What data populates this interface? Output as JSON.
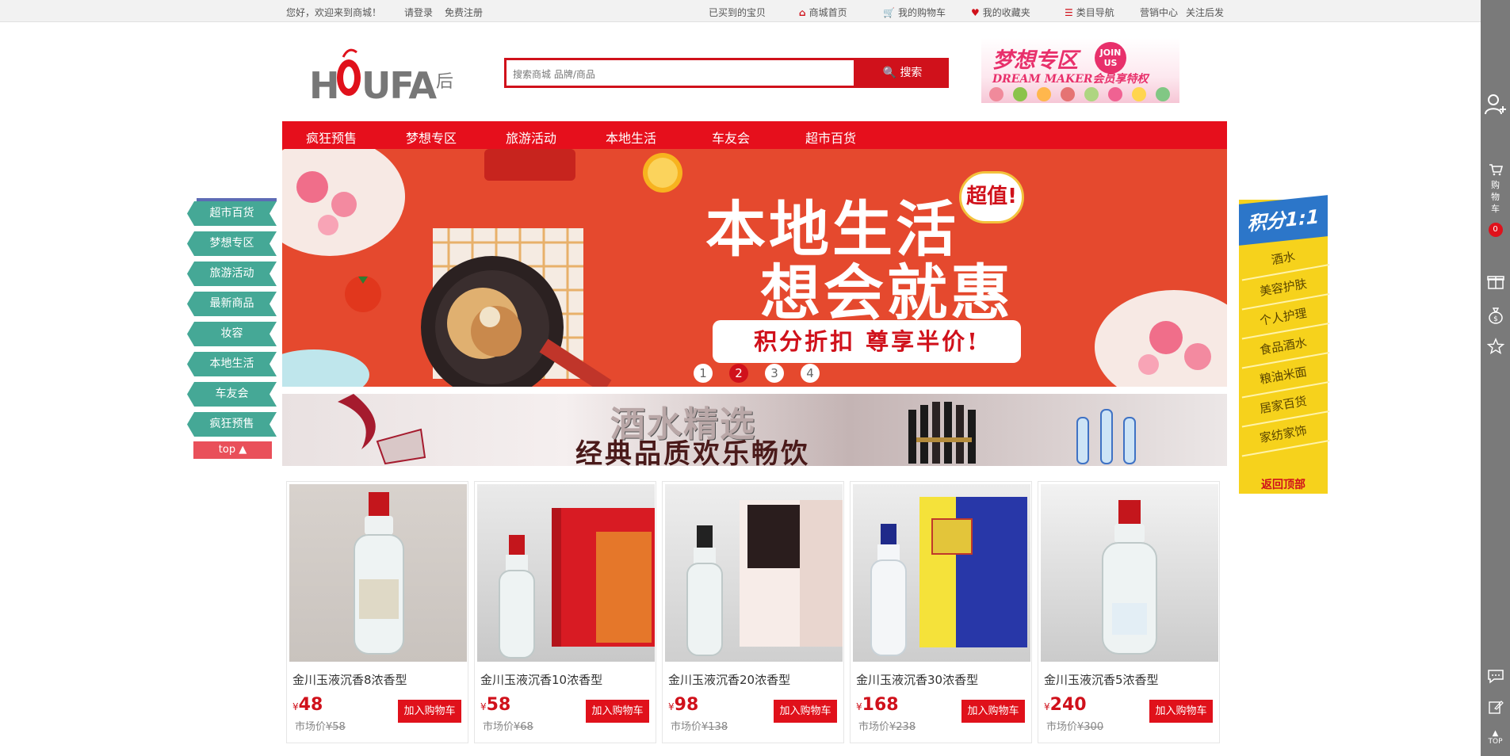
{
  "topbar": {
    "welcome": "您好，欢迎来到商城！",
    "login": "请登录",
    "register": "免费注册",
    "viewed": "已买到的宝贝",
    "home": "商城首页",
    "cart": "我的购物车",
    "favorites": "我的收藏夹",
    "categories": "类目导航",
    "marketing": "营销中心",
    "follow": "关注后发",
    "home_icon": "home-icon",
    "cart_icon": "cart-icon",
    "heart_icon": "heart-icon",
    "list_icon": "list-icon"
  },
  "logo": {
    "text": "HOUFA",
    "sub": "后发"
  },
  "search": {
    "placeholder": "搜索商城 品牌/商品",
    "button": "搜索"
  },
  "dream_ad": {
    "title": "梦想专区",
    "subtitle": "DREAM MAKER会员享特权",
    "badge_top": "JOIN",
    "badge_bottom": "US"
  },
  "nav": [
    "疯狂预售",
    "梦想专区",
    "旅游活动",
    "本地生活",
    "车友会",
    "超市百货"
  ],
  "banner": {
    "line1": "本地生活",
    "line2": "想会就惠",
    "bubble": "超值!",
    "pill": "积分折扣  尊享半价!",
    "dots": [
      "1",
      "2",
      "3",
      "4"
    ],
    "active_dot": 2
  },
  "liquor_banner": {
    "line1": "酒水精选",
    "line2": "经典品质欢乐畅饮"
  },
  "left_floor_nav": [
    "超市百货",
    "梦想专区",
    "旅游活动",
    "最新商品",
    "妆容",
    "本地生活",
    "车友会",
    "疯狂预售"
  ],
  "left_top_button": "top ▲",
  "points_panel": {
    "title": "积分1:1",
    "items": [
      "酒水",
      "美容护肤",
      "个人护理",
      "食品酒水",
      "粮油米面",
      "居家百货",
      "家纺家饰"
    ],
    "back_top": "返回顶部"
  },
  "right_sidebar": {
    "cart_label": "购物车",
    "cart_count": "0",
    "top_label": "TOP",
    "icons": [
      "user-add-icon",
      "cart-icon",
      "gift-icon",
      "money-bag-icon",
      "star-icon",
      "chat-icon",
      "edit-icon"
    ]
  },
  "products": [
    {
      "name": "金川玉液沉香8浓香型",
      "currency": "¥",
      "price": "48",
      "market_label": "市场价",
      "market_price": "¥58",
      "button": "加入购物车"
    },
    {
      "name": "金川玉液沉香10浓香型",
      "currency": "¥",
      "price": "58",
      "market_label": "市场价",
      "market_price": "¥68",
      "button": "加入购物车"
    },
    {
      "name": "金川玉液沉香20浓香型",
      "currency": "¥",
      "price": "98",
      "market_label": "市场价",
      "market_price": "¥138",
      "button": "加入购物车"
    },
    {
      "name": "金川玉液沉香30浓香型",
      "currency": "¥",
      "price": "168",
      "market_label": "市场价",
      "market_price": "¥238",
      "button": "加入购物车"
    },
    {
      "name": "金川玉液沉香5浓香型",
      "currency": "¥",
      "price": "240",
      "market_label": "市场价",
      "market_price": "¥300",
      "button": "加入购物车"
    }
  ],
  "colors": {
    "brand_red": "#d0111b",
    "nav_red": "#e60f1c",
    "teal": "#45a896",
    "yellow": "#f6d21c",
    "blue": "#2c76c9"
  }
}
